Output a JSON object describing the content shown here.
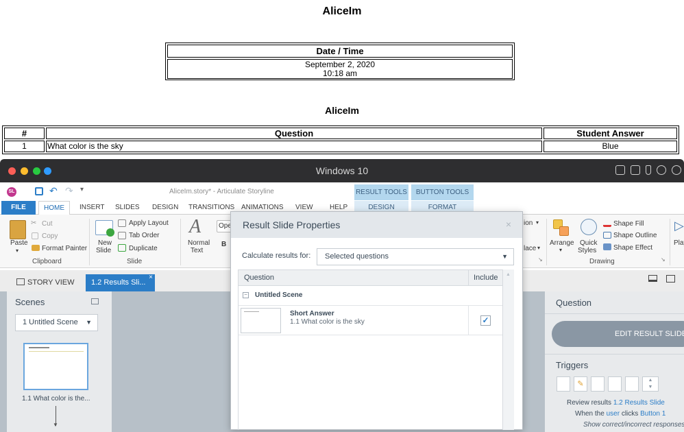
{
  "report": {
    "title": "AliceIm",
    "datetime_header": "Date / Time",
    "date": "September 2, 2020",
    "time": "10:18 am",
    "title2": "AliceIm",
    "columns": [
      "#",
      "Question",
      "Student Answer"
    ],
    "rows": [
      {
        "num": "1",
        "question": "What color is the sky",
        "answer": "Blue"
      }
    ]
  },
  "mac": {
    "title": "Windows 10",
    "dot_colors": [
      "#fc5f57",
      "#fdbc2e",
      "#28c941",
      "#2f9bff"
    ]
  },
  "app": {
    "logo": "SL",
    "title": "AliceIm.story* - Articulate Storyline",
    "context_groups": [
      {
        "label": "RESULT TOOLS",
        "tab": "DESIGN"
      },
      {
        "label": "BUTTON TOOLS",
        "tab": "FORMAT"
      }
    ],
    "tabs": {
      "file": "FILE",
      "home": "HOME",
      "insert": "INSERT",
      "slides": "SLIDES",
      "design": "DESIGN",
      "transitions": "TRANSITIONS",
      "animations": "ANIMATIONS",
      "view": "VIEW",
      "help": "HELP"
    }
  },
  "ribbon": {
    "paste": "Paste",
    "cut": "Cut",
    "copy": "Copy",
    "format_painter": "Format Painter",
    "clipboard": "Clipboard",
    "new_slide": "New",
    "new_slide2": "Slide",
    "apply_layout": "Apply Layout",
    "tab_order": "Tab Order",
    "duplicate": "Duplicate",
    "slide": "Slide",
    "normal_text": "Normal",
    "normal_text2": "Text",
    "bold": "B",
    "font_field": "Ope",
    "ion_partial": "ion",
    "lace_partial": "lace",
    "arrange": "Arrange",
    "quick_styles": "Quick",
    "quick_styles2": "Styles",
    "shape_fill": "Shape Fill",
    "shape_outline": "Shape Outline",
    "shape_effect": "Shape Effect",
    "drawing": "Drawing",
    "play_partial": "Play"
  },
  "doc_tabs": {
    "story_view": "STORY VIEW",
    "results": "1.2 Results Sli..."
  },
  "scenes": {
    "title": "Scenes",
    "dropdown": "1 Untitled Scene",
    "thumb_caption": "1.1 What color is the..."
  },
  "right_panel": {
    "question": "Question",
    "edit_button": "EDIT RESULT SLIDE",
    "triggers": "Triggers",
    "trigger_line1_a": "Review results",
    "trigger_line1_b": "1.2 Results Slide",
    "trigger_line2_a": "When the",
    "trigger_line2_b": "user",
    "trigger_line2_c": "clicks",
    "trigger_line2_d": "Button 1",
    "trigger_line3": "Show correct/incorrect responses"
  },
  "dialog": {
    "title": "Result Slide Properties",
    "close": "×",
    "calc_label": "Calculate results for:",
    "calc_value": "Selected questions",
    "col_question": "Question",
    "col_include": "Include",
    "scene_name": "Untitled Scene",
    "item_type": "Short Answer",
    "item_text": "1.1 What color is the sky",
    "item_included": true
  }
}
